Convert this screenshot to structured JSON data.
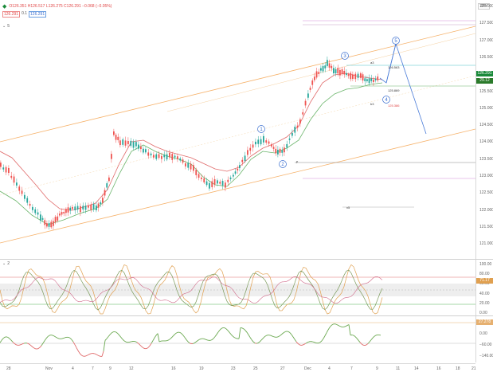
{
  "header": {
    "symbol_icon": "tradingview-logo-icon",
    "ohlc": "O126.351 H126.517 L126.275 C126.291 −0.068 (−0.05%)",
    "bid": "126.291",
    "spread": "0.1",
    "ask": "126.291",
    "currency": "JPY",
    "indicator_badge": "5",
    "osc_badge": "2"
  },
  "price_axis": {
    "ticks": [
      "128.000",
      "127.500",
      "127.000",
      "126.500",
      "126.000",
      "125.500",
      "125.000",
      "124.500",
      "124.000",
      "123.500",
      "123.000",
      "122.500",
      "122.000",
      "121.500",
      "121.000"
    ],
    "current_price": "126.291",
    "current_tag2": "29.12"
  },
  "osc_axis": {
    "ticks": [
      "100.00",
      "80.00",
      "60.00",
      "40.00",
      "20.00",
      "0.00"
    ],
    "current": "71.17"
  },
  "mom_axis": {
    "ticks": [
      "60.00",
      "0.00",
      "−60.00",
      "−140.00"
    ],
    "current": "27.278"
  },
  "time_axis": {
    "ticks": [
      "28",
      "Nov",
      "4",
      "7",
      "9",
      "12",
      "16",
      "19",
      "23",
      "25",
      "27",
      "Dec",
      "4",
      "7",
      "9",
      "11",
      "14",
      "16",
      "18",
      "21",
      "23"
    ]
  },
  "waves": [
    "1",
    "2",
    "3",
    "4",
    "5"
  ],
  "annotations": {
    "level_a": "126.563",
    "level_b": "125.869",
    "level_c": "125.386",
    "mark_a": "a3",
    "mark_b": "b3",
    "mark_p": "p",
    "mark_x": "x5"
  },
  "colors": {
    "up": "#26a69a",
    "down": "#ef5350",
    "channel": "#f6b26b",
    "projection": "#4a7cd8",
    "price_tag": "#1a8a3a"
  }
}
